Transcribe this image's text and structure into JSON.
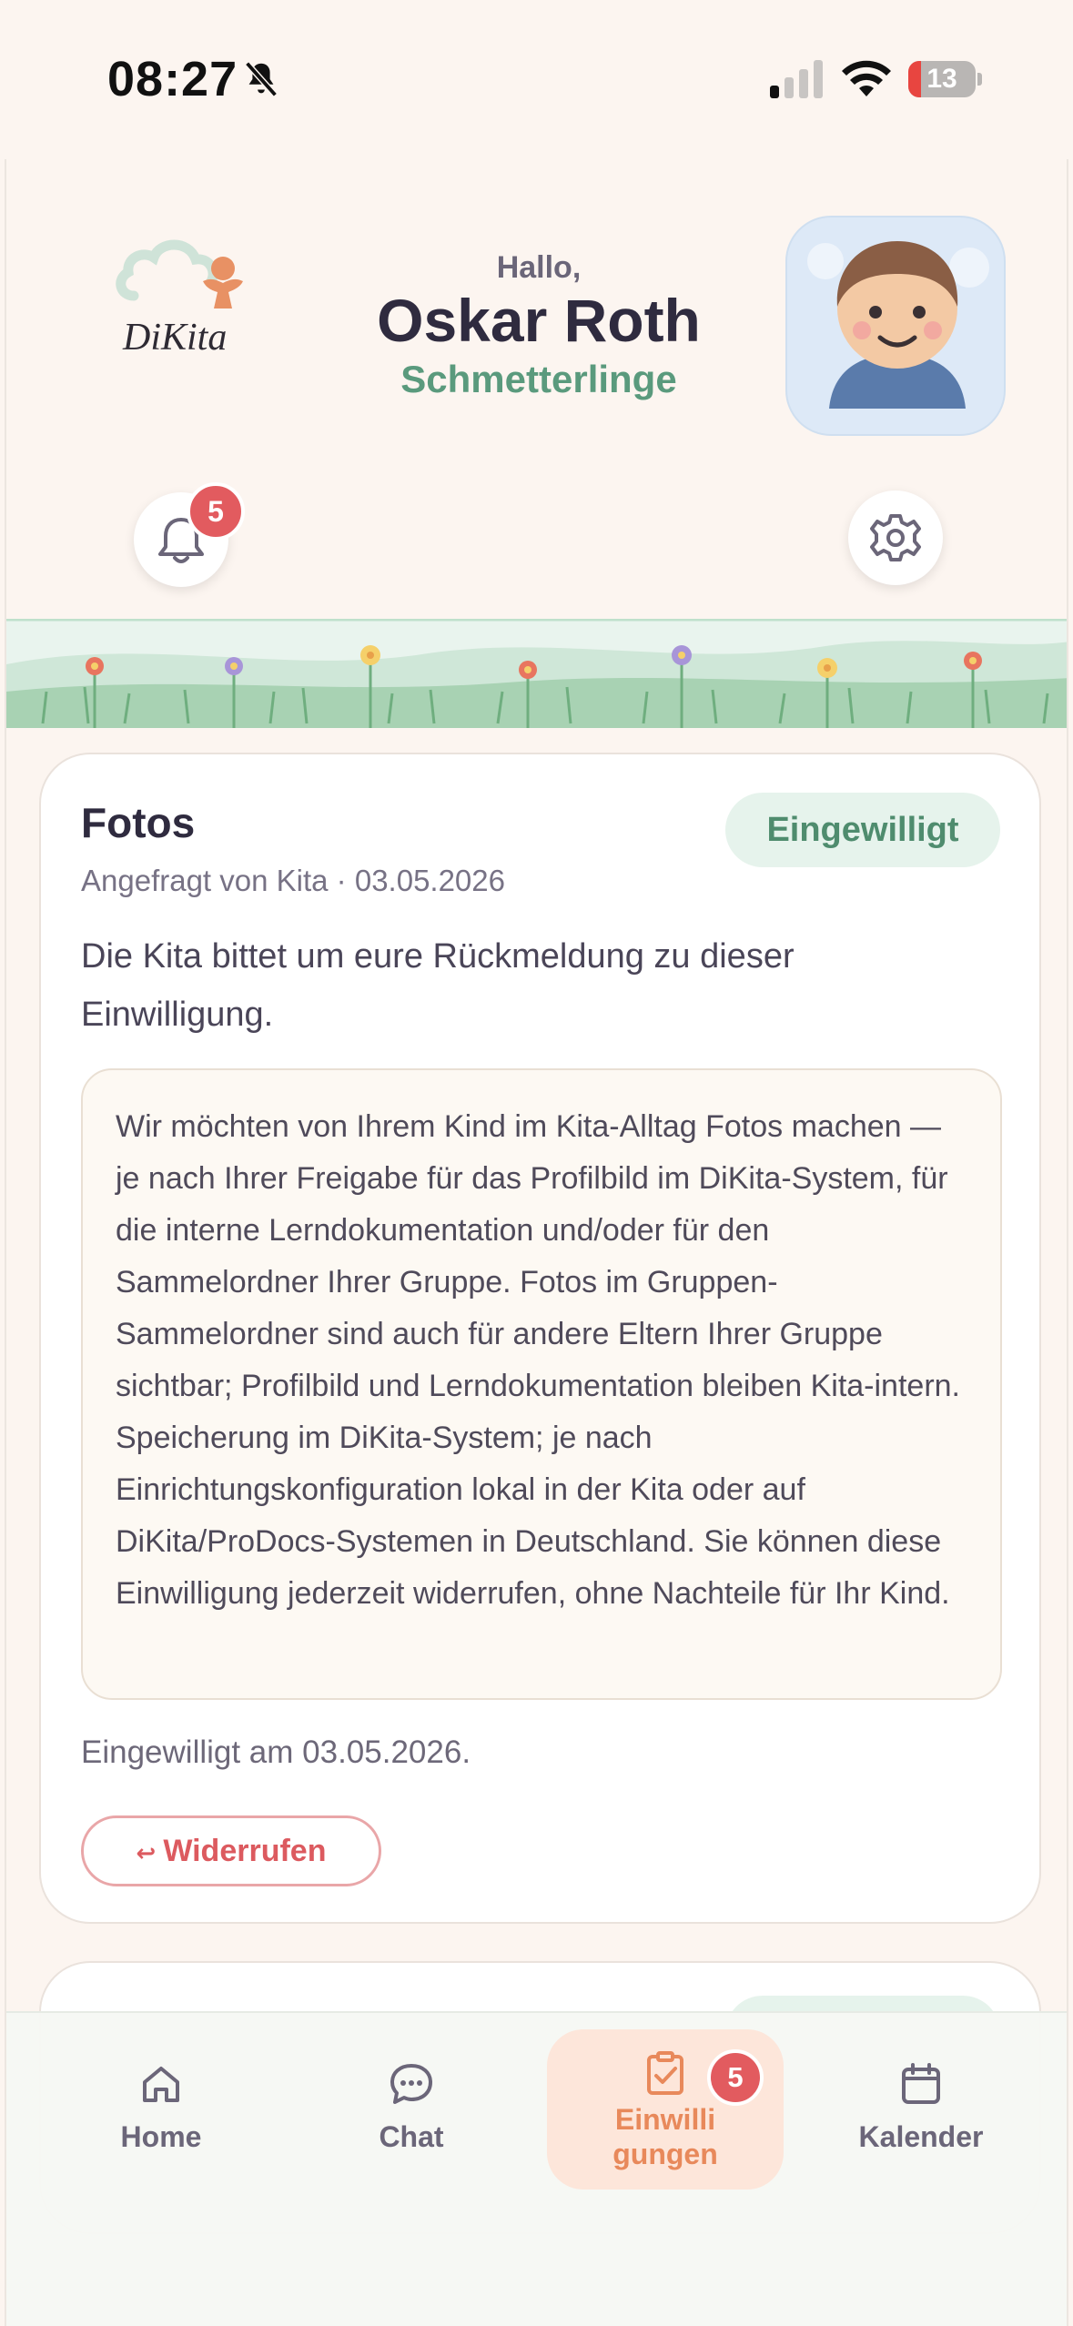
{
  "status_bar": {
    "time": "08:27",
    "battery": "13"
  },
  "header": {
    "logo_text": "DiKita",
    "greeting": "Hallo,",
    "parent_name": "Oskar Roth",
    "group_name": "Schmetterlinge",
    "notification_count": "5"
  },
  "consent_card": {
    "title": "Fotos",
    "status": "Eingewilligt",
    "meta": "Angefragt von Kita · 03.05.2026",
    "intro": "Die Kita bittet um eure Rückmeldung zu dieser Einwilligung.",
    "text": "Wir möchten von Ihrem Kind im Kita-Alltag Fotos machen — je nach Ihrer Freigabe für das Profilbild im DiKita-System, für die interne Lerndokumentation und/oder für den Sammelordner Ihrer Gruppe. Fotos im Gruppen-Sammelordner sind auch für andere Eltern Ihrer Gruppe sichtbar; Profilbild und Lerndokumentation bleiben Kita-intern. Speicherung im DiKita-System; je nach Einrichtungskonfiguration lokal in der Kita oder auf DiKita/ProDocs-Systemen in Deutschland. Sie können diese Einwilligung jederzeit widerrufen, ohne Nachteile für Ihr Kind.",
    "consented_at": "Eingewilligt am 03.05.2026.",
    "revoke_icon": "↩",
    "revoke_label": "Widerrufen"
  },
  "tabbar": {
    "tabs": [
      {
        "label": "Home",
        "icon": "home-icon"
      },
      {
        "label": "Chat",
        "icon": "chat-icon"
      },
      {
        "label": "Einwilligungen",
        "icon": "consent-icon"
      },
      {
        "label": "Kalender",
        "icon": "calendar-icon"
      }
    ],
    "consent_badge": "5"
  },
  "colors": {
    "accent_green": "#5a9a7d",
    "accent_orange": "#e8895b",
    "badge_red": "#e25b5f"
  }
}
